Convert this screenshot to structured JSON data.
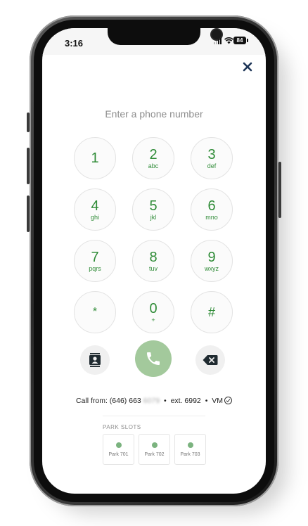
{
  "status_bar": {
    "time": "3:16",
    "battery": "84",
    "icons": [
      "signal-icon",
      "wifi-icon",
      "battery-icon"
    ]
  },
  "dialer": {
    "placeholder": "Enter a phone number",
    "keys": [
      {
        "digit": "1",
        "letters": ""
      },
      {
        "digit": "2",
        "letters": "abc"
      },
      {
        "digit": "3",
        "letters": "def"
      },
      {
        "digit": "4",
        "letters": "ghi"
      },
      {
        "digit": "5",
        "letters": "jkl"
      },
      {
        "digit": "6",
        "letters": "mno"
      },
      {
        "digit": "7",
        "letters": "pqrs"
      },
      {
        "digit": "8",
        "letters": "tuv"
      },
      {
        "digit": "9",
        "letters": "wxyz"
      },
      {
        "digit": "*",
        "letters": ""
      },
      {
        "digit": "0",
        "letters": "+"
      },
      {
        "digit": "#",
        "letters": ""
      }
    ],
    "actions": [
      "contacts-icon",
      "phone-icon",
      "backspace-icon"
    ]
  },
  "call_from": {
    "label": "Call from:",
    "number_visible": "(646) 663",
    "number_masked": "6079",
    "bullet": "•",
    "extension": "ext. 6992",
    "voicemail": "VM"
  },
  "park_slots": {
    "title": "PARK SLOTS",
    "slots": [
      {
        "label": "Park 701"
      },
      {
        "label": "Park 702"
      },
      {
        "label": "Park 703"
      }
    ]
  },
  "colors": {
    "accent_green": "#2e8b36",
    "call_button": "#a3c99c",
    "navy": "#1d3557",
    "slot_dot": "#7bb37f"
  }
}
